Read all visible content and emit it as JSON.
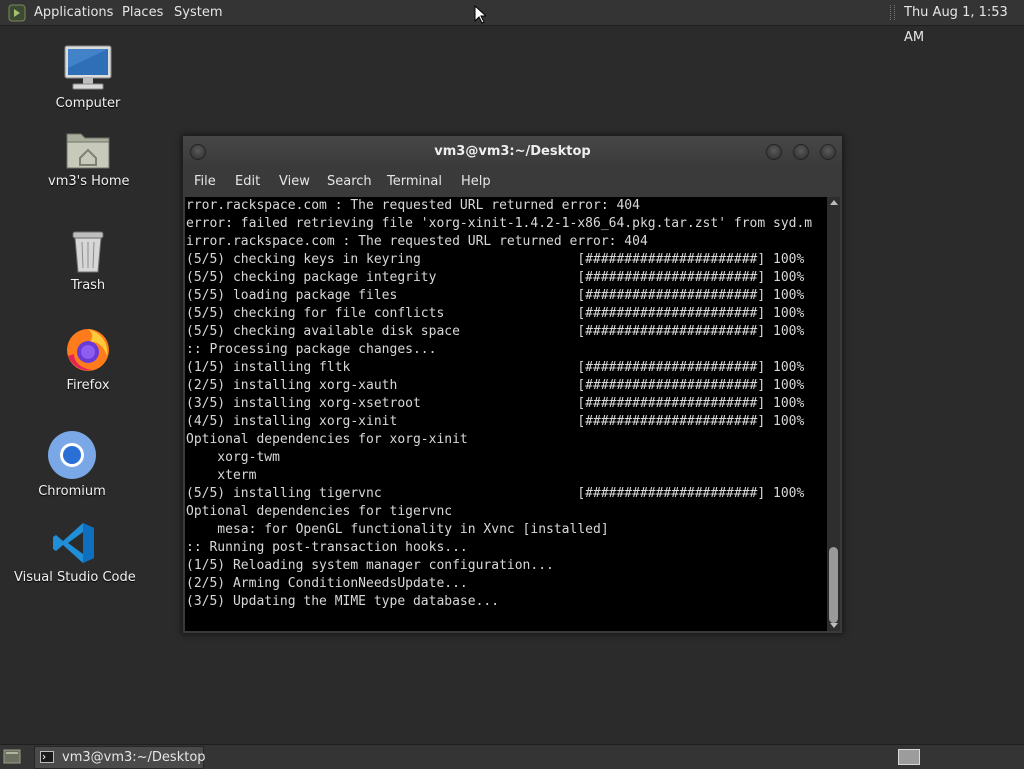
{
  "top_panel": {
    "menus": [
      "Applications",
      "Places",
      "System"
    ],
    "clock": "Thu Aug  1,  1:53 AM"
  },
  "desktop": {
    "icons": [
      {
        "label": "Computer",
        "icon": "computer-icon"
      },
      {
        "label": "vm3's Home",
        "icon": "home-folder-icon"
      },
      {
        "label": "Trash",
        "icon": "trash-icon"
      },
      {
        "label": "Firefox",
        "icon": "firefox-icon"
      },
      {
        "label": "Chromium",
        "icon": "chromium-icon"
      },
      {
        "label": "Visual Studio Code",
        "icon": "vscode-icon"
      }
    ]
  },
  "terminal": {
    "title": "vm3@vm3:~/Desktop",
    "menu": [
      "File",
      "Edit",
      "View",
      "Search",
      "Terminal",
      "Help"
    ],
    "lines": [
      "rror.rackspace.com : The requested URL returned error: 404",
      "error: failed retrieving file 'xorg-xinit-1.4.2-1-x86_64.pkg.tar.zst' from syd.m",
      "irror.rackspace.com : The requested URL returned error: 404",
      "(5/5) checking keys in keyring                    [######################] 100%",
      "(5/5) checking package integrity                  [######################] 100%",
      "(5/5) loading package files                       [######################] 100%",
      "(5/5) checking for file conflicts                 [######################] 100%",
      "(5/5) checking available disk space               [######################] 100%",
      ":: Processing package changes...",
      "(1/5) installing fltk                             [######################] 100%",
      "(2/5) installing xorg-xauth                       [######################] 100%",
      "(3/5) installing xorg-xsetroot                    [######################] 100%",
      "(4/5) installing xorg-xinit                       [######################] 100%",
      "Optional dependencies for xorg-xinit",
      "    xorg-twm",
      "    xterm",
      "(5/5) installing tigervnc                         [######################] 100%",
      "Optional dependencies for tigervnc",
      "    mesa: for OpenGL functionality in Xvnc [installed]",
      ":: Running post-transaction hooks...",
      "(1/5) Reloading system manager configuration...",
      "(2/5) Arming ConditionNeedsUpdate...",
      "(3/5) Updating the MIME type database..."
    ]
  },
  "taskbar": {
    "task_label": "vm3@vm3:~/Desktop"
  },
  "colors": {
    "desktop_bg": "#2b2b2b",
    "panel_bg": "#343434",
    "terminal_bg": "#000000",
    "terminal_fg": "#d8d8d8"
  }
}
